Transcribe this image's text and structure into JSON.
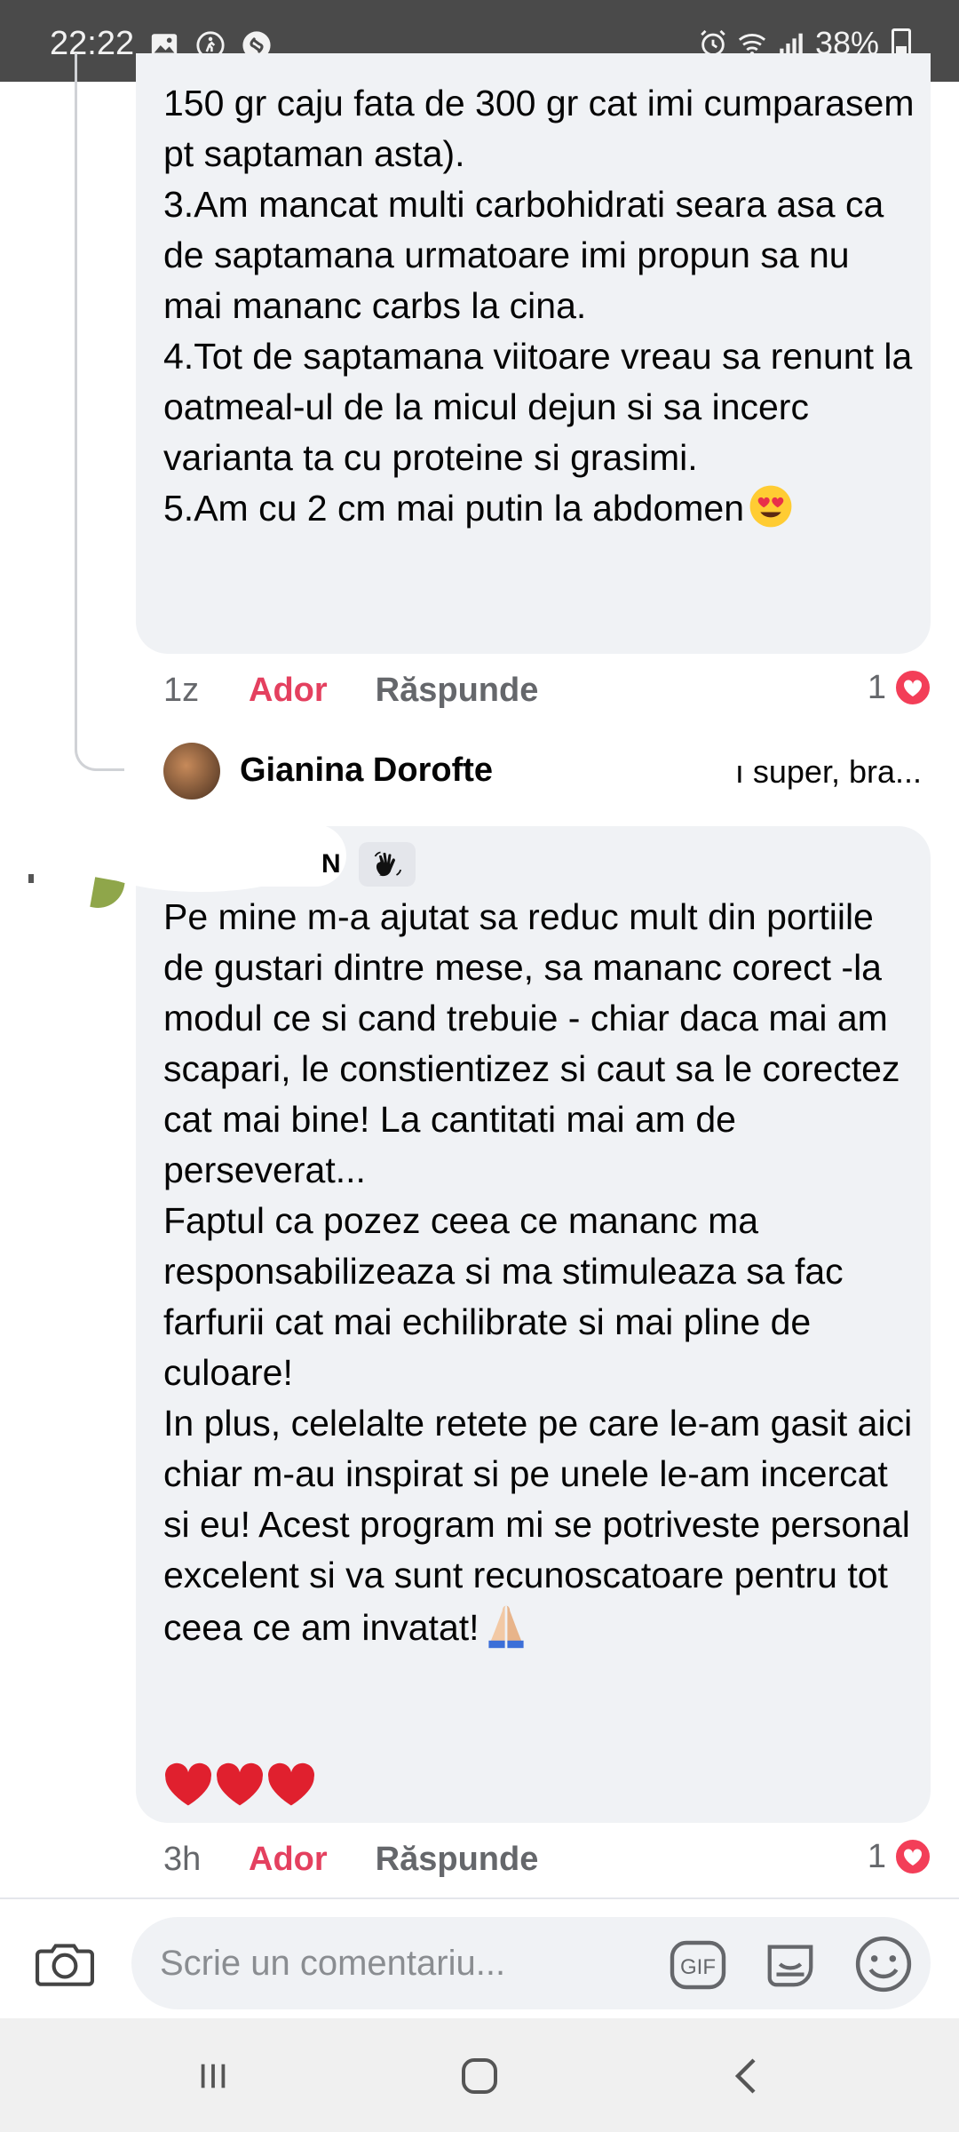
{
  "status_bar": {
    "time": "22:22",
    "battery": "38%",
    "icons": [
      "image-icon",
      "accessibility-icon",
      "shazam-icon",
      "alarm-icon",
      "wifi-icon",
      "signal-icon",
      "battery-icon"
    ]
  },
  "comment1": {
    "text": "150 gr caju fata de 300 gr cat imi cumparasem pt saptaman asta).\n3.Am mancat multi carbohidrati seara asa ca de saptamana urmatoare imi propun sa nu mai mananc carbs la cina.\n4.Tot de saptamana viitoare vreau sa renunt la oatmeal-ul de la micul dejun si sa incerc varianta ta cu proteine si grasimi.\n5.Am cu 2 cm mai putin la abdomen",
    "emoji": "heart-eyes-emoji",
    "age": "1z",
    "love_label": "Ador",
    "reply_label": "Răspunde",
    "reaction_count": "1"
  },
  "reply_preview": {
    "name": "Gianina Dorofte",
    "snippet": "ı super, bra..."
  },
  "comment2": {
    "author_fragment": "N",
    "text": "Pe mine m-a ajutat sa reduc mult din portiile de gustari dintre mese, sa mananc corect -la modul ce si cand trebuie - chiar daca mai am scapari, le constientizez si caut sa le corectez cat mai bine! La cantitati mai am de perseverat...\nFaptul ca pozez ceea ce mananc ma responsabilizeaza si ma stimuleaza sa fac farfurii cat mai echilibrate si mai pline de culoare!\nIn plus, celelalte retete pe care le-am gasit aici chiar m-au inspirat si pe unele le-am incercat si eu! Acest program mi se potriveste personal excelent si va sunt recunoscatoare pentru tot ceea ce am invatat!",
    "emoji": "folded-hands-emoji",
    "hearts": "❤️❤️❤️",
    "age": "3h",
    "love_label": "Ador",
    "reply_label": "Răspunde",
    "reaction_count": "1"
  },
  "composer": {
    "placeholder": "Scrie un comentariu...",
    "gif_label": "GIF"
  },
  "colors": {
    "bubble": "#f0f2f5",
    "love": "#e4405f",
    "muted": "#65676b",
    "status_bar": "#4a4a4a"
  }
}
